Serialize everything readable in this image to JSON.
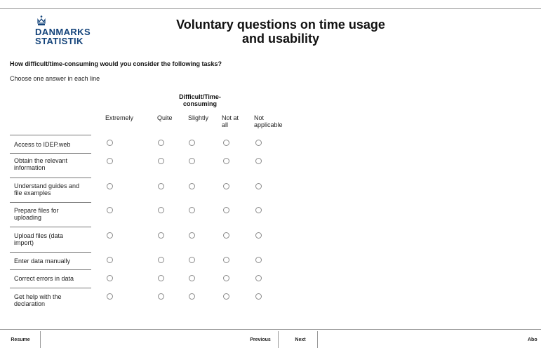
{
  "logo": {
    "line1": "DANMARKS",
    "line2": "STATISTIK",
    "color": "#13437a"
  },
  "title": {
    "line1": "Voluntary questions on time usage",
    "line2": "and usability"
  },
  "question": "How difficult/time-consuming would you consider the following tasks?",
  "instruction": "Choose one answer in each line",
  "group_header": {
    "line1": "Difficult/Time-",
    "line2": "consuming"
  },
  "columns": [
    {
      "line1": "Extremely",
      "line2": ""
    },
    {
      "line1": "Quite",
      "line2": ""
    },
    {
      "line1": "Slightly",
      "line2": ""
    },
    {
      "line1": "Not at",
      "line2": "all"
    },
    {
      "line1": "Not",
      "line2": "applicable"
    }
  ],
  "rows": [
    {
      "line1": "Access to IDEP.web",
      "line2": ""
    },
    {
      "line1": "Obtain the relevant",
      "line2": "information"
    },
    {
      "line1": "Understand guides and",
      "line2": "file examples"
    },
    {
      "line1": "Prepare files for",
      "line2": "uploading"
    },
    {
      "line1": "Upload files (data",
      "line2": "import)"
    },
    {
      "line1": "Enter data manually",
      "line2": ""
    },
    {
      "line1": "Correct errors in data",
      "line2": ""
    },
    {
      "line1": "Get help with the",
      "line2": "declaration"
    }
  ],
  "nav": {
    "resume": "Resume",
    "previous": "Previous",
    "next": "Next",
    "about": "Abo"
  }
}
